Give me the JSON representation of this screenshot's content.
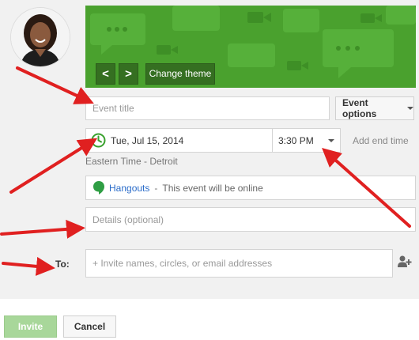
{
  "banner": {
    "prev_label": "<",
    "next_label": ">",
    "change_theme_label": "Change theme",
    "color": "#4aa12e"
  },
  "event": {
    "title_placeholder": "Event title",
    "options_label": "Event options",
    "date_value": "Tue, Jul 15, 2014",
    "time_value": "3:30 PM",
    "add_end_time_label": "Add end time",
    "timezone": "Eastern Time - Detroit",
    "details_placeholder": "Details (optional)"
  },
  "hangouts": {
    "link_label": "Hangouts",
    "separator": "-",
    "description": "This event will be online"
  },
  "invite": {
    "to_label": "To:",
    "placeholder": "+ Invite names, circles, or email addresses"
  },
  "actions": {
    "invite_label": "Invite",
    "cancel_label": "Cancel"
  },
  "icons": {
    "clock": "clock-icon",
    "hangouts": "hangouts-icon",
    "add_person": "add-person-icon"
  },
  "colors": {
    "accent_green": "#4aa12e",
    "arrow_red": "#e02020",
    "link_blue": "#2a6cc9"
  }
}
